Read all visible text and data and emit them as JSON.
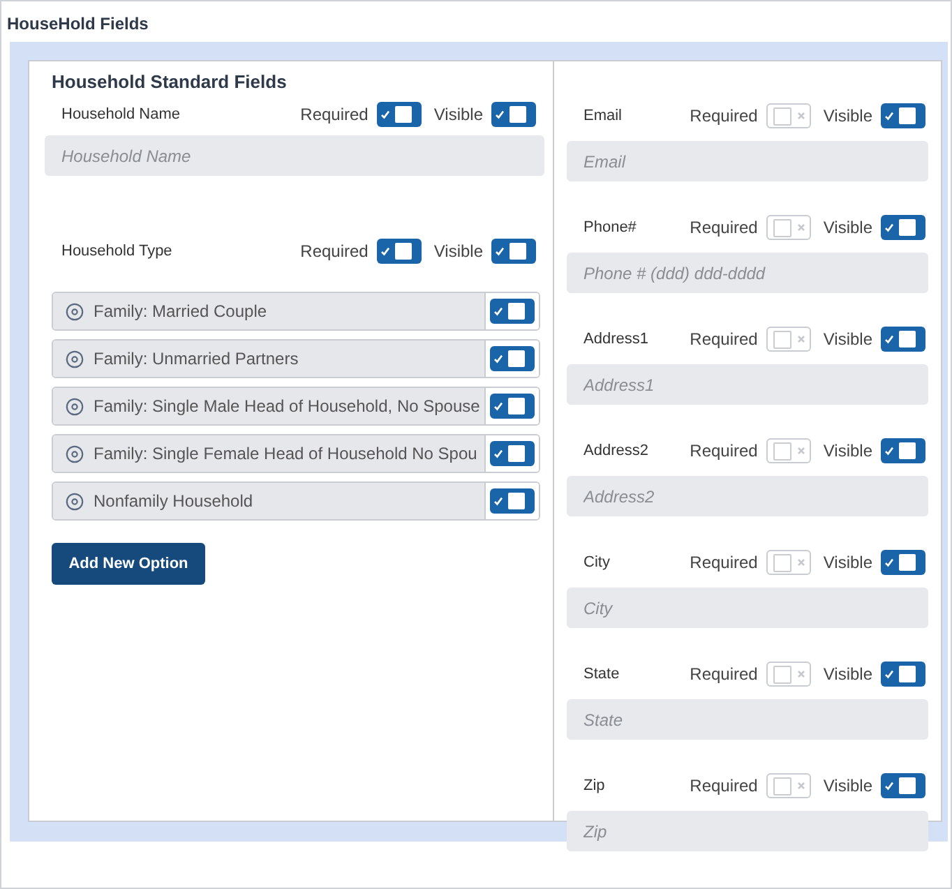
{
  "title": "HouseHold Fields",
  "standard": {
    "heading": "Household Standard Fields",
    "household_name": {
      "label": "Household Name",
      "required_label": "Required",
      "required": true,
      "visible_label": "Visible",
      "visible": true,
      "placeholder": "Household Name"
    },
    "household_type": {
      "label": "Household Type",
      "required_label": "Required",
      "required": true,
      "visible_label": "Visible",
      "visible": true,
      "options": [
        {
          "label": "Family: Married Couple",
          "on": true
        },
        {
          "label": "Family: Unmarried Partners",
          "on": true
        },
        {
          "label": "Family: Single Male Head of Household, No Spouse",
          "on": true
        },
        {
          "label": "Family: Single Female Head of Household No Spou",
          "on": true
        },
        {
          "label": "Nonfamily Household",
          "on": true
        }
      ],
      "add_button": "Add New Option"
    }
  },
  "fields": [
    {
      "label": "Email",
      "required_label": "Required",
      "required": false,
      "visible_label": "Visible",
      "visible": true,
      "placeholder": "Email"
    },
    {
      "label": "Phone#",
      "required_label": "Required",
      "required": false,
      "visible_label": "Visible",
      "visible": true,
      "placeholder": "Phone # (ddd) ddd-dddd"
    },
    {
      "label": "Address1",
      "required_label": "Required",
      "required": false,
      "visible_label": "Visible",
      "visible": true,
      "placeholder": "Address1"
    },
    {
      "label": "Address2",
      "required_label": "Required",
      "required": false,
      "visible_label": "Visible",
      "visible": true,
      "placeholder": "Address2"
    },
    {
      "label": "City",
      "required_label": "Required",
      "required": false,
      "visible_label": "Visible",
      "visible": true,
      "placeholder": "City"
    },
    {
      "label": "State",
      "required_label": "Required",
      "required": false,
      "visible_label": "Visible",
      "visible": true,
      "placeholder": "State"
    },
    {
      "label": "Zip",
      "required_label": "Required",
      "required": false,
      "visible_label": "Visible",
      "visible": true,
      "placeholder": "Zip"
    }
  ]
}
